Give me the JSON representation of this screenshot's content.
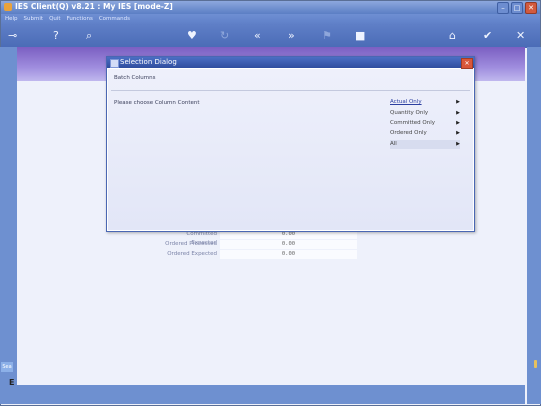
{
  "window": {
    "title": "IES Client(Q) v8.21 : My IES      [mode-Z]",
    "controls": {
      "minimize": "–",
      "maximize": "□",
      "close": "✕"
    }
  },
  "menu": {
    "items": [
      "Help",
      "Submit",
      "Quit",
      "Functions",
      "Commands"
    ]
  },
  "toolbar": {
    "icons": [
      "key-icon",
      "help-icon",
      "search-icon",
      "heart-icon",
      "refresh-icon",
      "rewind-icon",
      "forward-icon",
      "flag-icon",
      "stop-icon",
      "home-icon",
      "check-icon",
      "close-icon"
    ]
  },
  "form": {
    "rows": [
      {
        "label": "Committed Expected",
        "value": "0.00"
      },
      {
        "label": "Ordered Processed",
        "value": "0.00"
      },
      {
        "label": "Ordered Expected",
        "value": "0.00"
      }
    ]
  },
  "dialog": {
    "title": "Selection Dialog",
    "close": "✕",
    "heading": "Batch Columns",
    "prompt": "Please choose Column Content",
    "options": [
      {
        "label": "Actual Only",
        "arrow": "▶",
        "state": "selected"
      },
      {
        "label": "Quantity Only",
        "arrow": "▶",
        "state": ""
      },
      {
        "label": "Committed Only",
        "arrow": "▶",
        "state": ""
      },
      {
        "label": "Ordered Only",
        "arrow": "▶",
        "state": ""
      },
      {
        "label": "All",
        "arrow": "▶",
        "state": "current"
      }
    ]
  },
  "sidebar": {
    "tab_label": "Sea",
    "letter": "E"
  }
}
